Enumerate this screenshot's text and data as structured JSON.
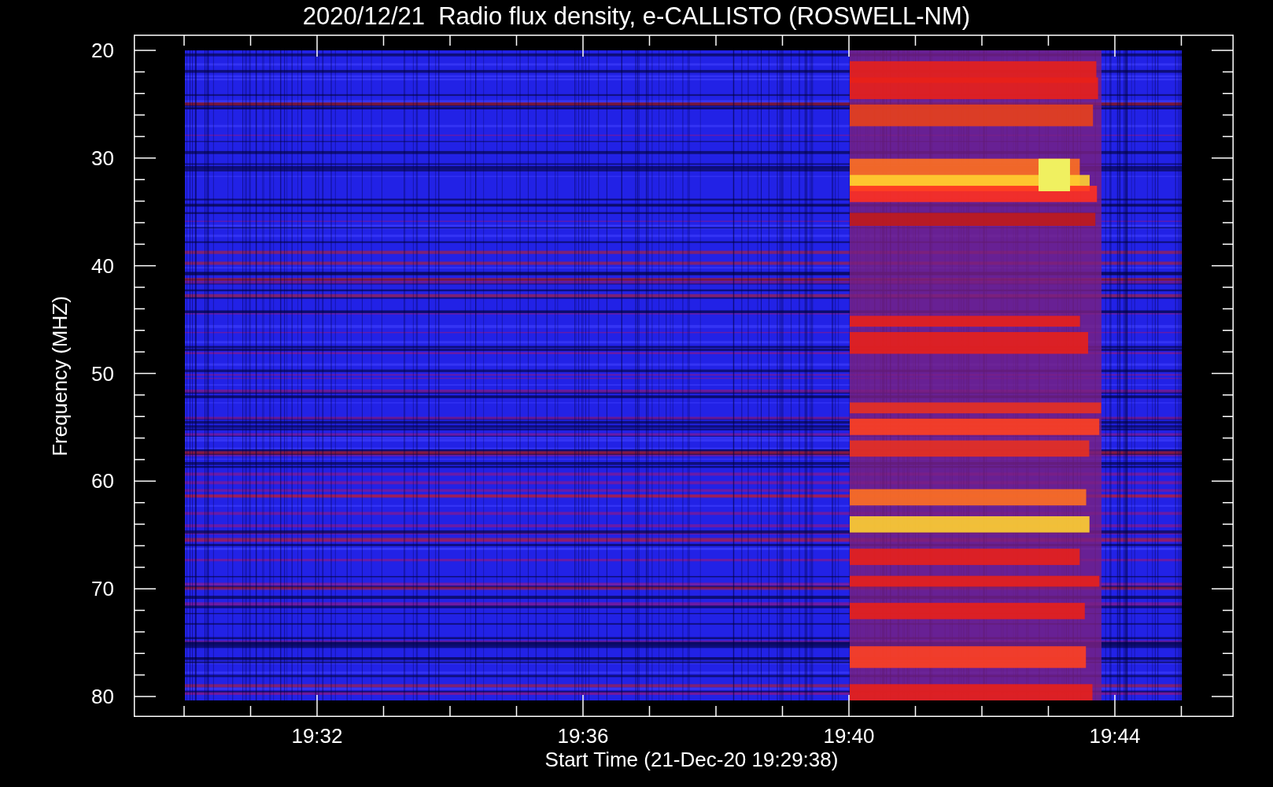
{
  "title": "2020/12/21  Radio flux density, e-CALLISTO (ROSWELL-NM)",
  "y_axis": {
    "label": "Frequency (MHZ)",
    "ticks": [
      "20",
      "30",
      "40",
      "50",
      "60",
      "70",
      "80"
    ]
  },
  "x_axis": {
    "label": "Start Time (21-Dec-20 19:29:38)",
    "ticks": [
      "19:32",
      "19:36",
      "19:40",
      "19:44"
    ]
  }
}
